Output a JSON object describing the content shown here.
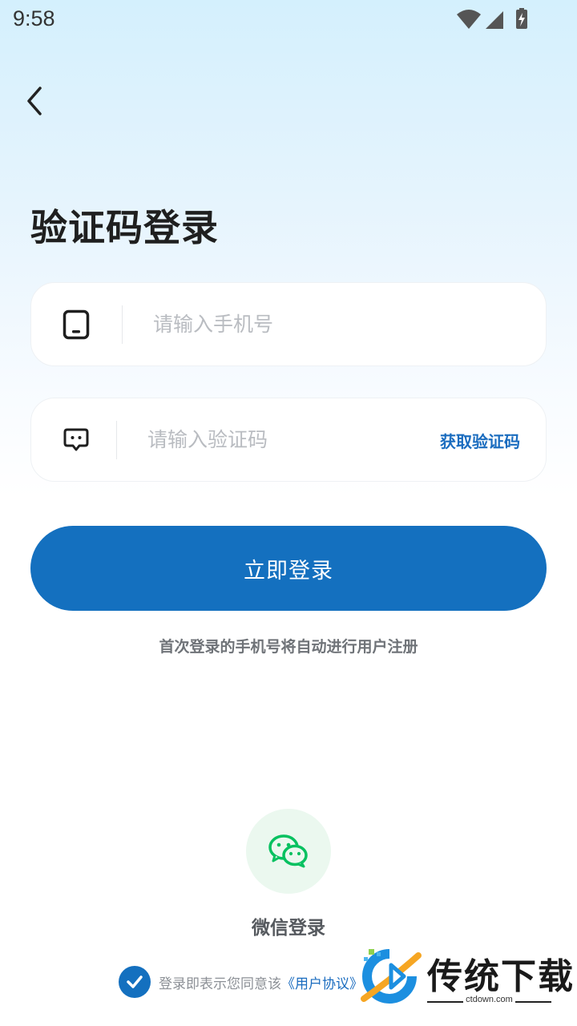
{
  "status_bar": {
    "time": "9:58",
    "icons": [
      "wifi-icon",
      "signal-icon",
      "battery-charging-icon"
    ]
  },
  "header": {
    "back_icon": "chevron-left-icon",
    "title": "验证码登录"
  },
  "form": {
    "phone": {
      "icon": "phone-icon",
      "value": "",
      "placeholder": "请输入手机号"
    },
    "code": {
      "icon": "message-icon",
      "value": "",
      "placeholder": "请输入验证码",
      "get_code_label": "获取验证码"
    },
    "submit_label": "立即登录",
    "hint": "首次登录的手机号将自动进行用户注册"
  },
  "third_party": {
    "wechat_icon": "wechat-icon",
    "wechat_label": "微信登录"
  },
  "agreement": {
    "checked": true,
    "text": "登录即表示您同意该",
    "link": "《用户协议》"
  },
  "watermark": {
    "brand": "传统下载",
    "url": "ctdown.com"
  },
  "colors": {
    "accent": "#1470bf",
    "link": "#1a6cbf",
    "wechat_green": "#07c160"
  }
}
